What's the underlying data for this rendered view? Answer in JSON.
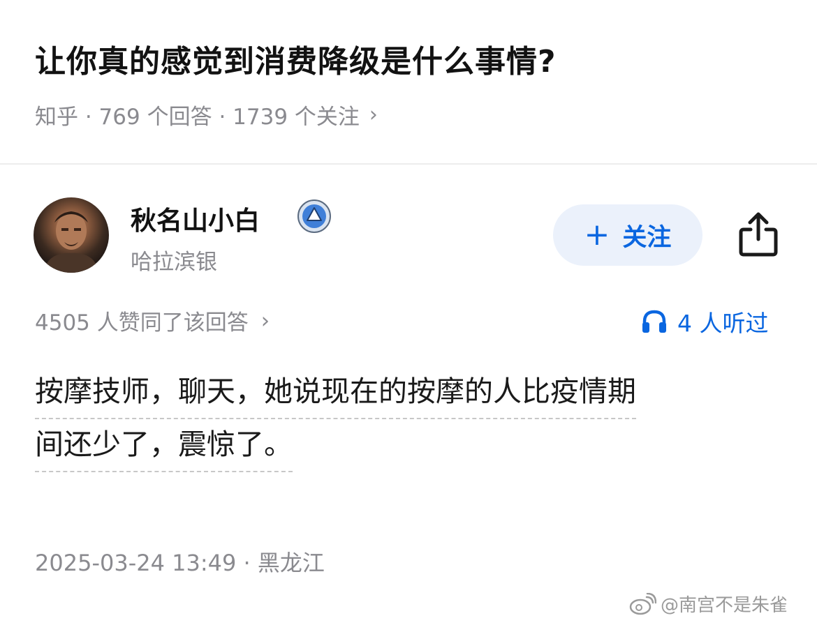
{
  "question": {
    "title": "让你真的感觉到消费降级是什么事情?",
    "meta": "知乎 · 769 个回答 · 1739 个关注",
    "chevron": "›"
  },
  "author": {
    "name": "秋名山小白",
    "location": "哈拉滨银",
    "avatar_icon": "user-avatar",
    "verified_icon": "verified-badge-icon"
  },
  "actions": {
    "follow_plus": "+",
    "follow_label": "关注",
    "share_icon": "share-icon"
  },
  "answer": {
    "upvote_summary": "4505 人赞同了该回答",
    "upvote_chevron": "›",
    "listen_count": "4 人听过",
    "listen_icon": "headphones-icon",
    "body_line_1": "按摩技师，聊天，她说现在的按摩的人比疫情期",
    "body_line_2": "间还少了，震惊了。",
    "timestamp": "2025-03-24 13:49 · 黑龙江"
  },
  "watermark": {
    "text": "@南宫不是朱雀",
    "icon": "weibo-icon"
  },
  "colors": {
    "accent": "#0a66e0",
    "follow_bg": "#ebf1fb",
    "muted_text": "#8a8a8f"
  }
}
